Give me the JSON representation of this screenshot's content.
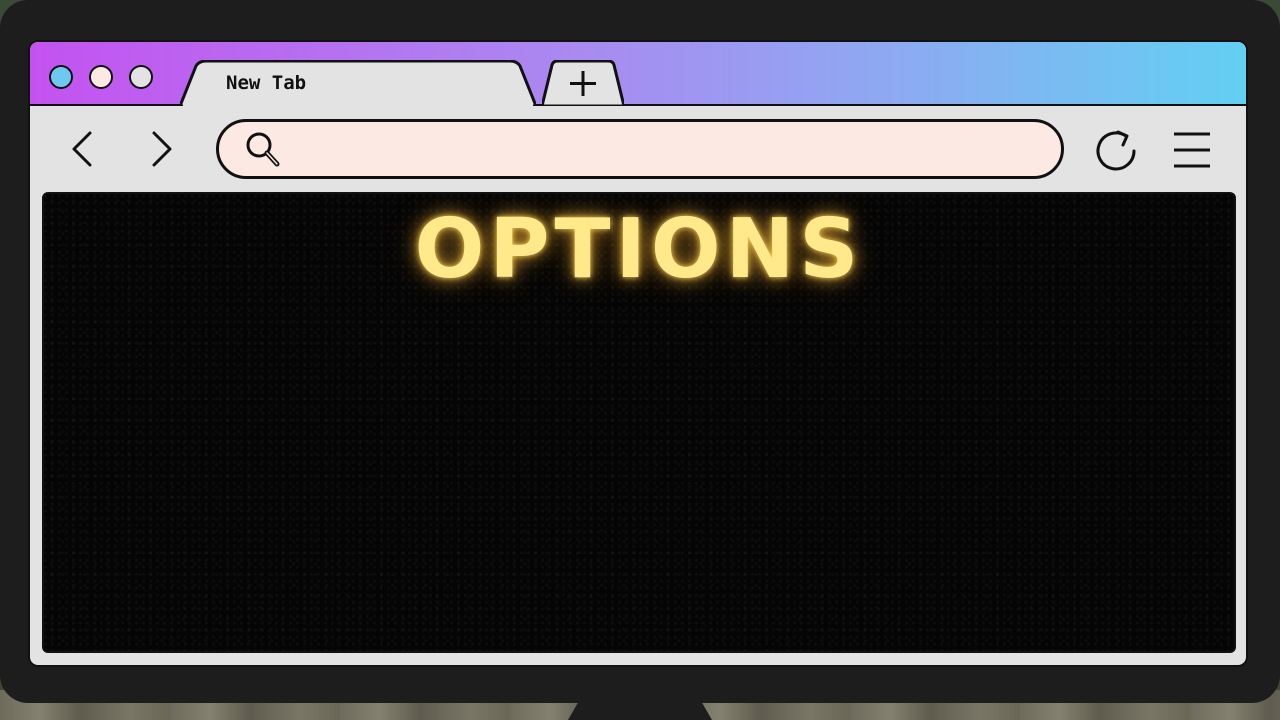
{
  "browser": {
    "window_controls": [
      {
        "name": "close",
        "color": "#6fc9ef"
      },
      {
        "name": "minimize",
        "color": "#fde9e4"
      },
      {
        "name": "maximize",
        "color": "#e3e3e3"
      }
    ],
    "tabs": [
      {
        "label": "New Tab",
        "active": true
      }
    ],
    "new_tab_icon": "plus-icon",
    "toolbar": {
      "back_icon": "chevron-left-icon",
      "forward_icon": "chevron-right-icon",
      "reload_icon": "reload-icon",
      "menu_icon": "hamburger-menu-icon"
    },
    "address_bar": {
      "value": "",
      "placeholder": "",
      "icon": "search-icon"
    }
  },
  "page": {
    "title": "OPTIONS"
  },
  "colors": {
    "tabstrip_gradient": [
      "#c452f0",
      "#a98af0",
      "#8fa8f2",
      "#62d0f2"
    ],
    "tab_fill": "#e3e3e3",
    "address_bar_fill": "#fde9e4",
    "page_background": "#050505",
    "title_glow": "#ffe98a"
  }
}
